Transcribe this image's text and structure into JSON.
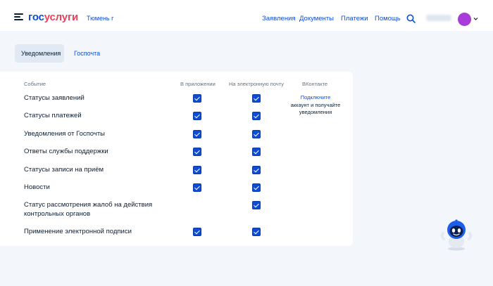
{
  "header": {
    "logo_part1": "гос",
    "logo_part2": "услуги",
    "city": "Тюмень г",
    "nav": [
      "Заявления",
      "Документы",
      "Платежи",
      "Помощь"
    ]
  },
  "tabs": [
    {
      "label": "Уведомления",
      "active": true
    },
    {
      "label": "Госпочта",
      "active": false
    }
  ],
  "table": {
    "columns": [
      "Событие",
      "В приложении",
      "На электронную почту",
      "ВКонтакте"
    ],
    "rows": [
      {
        "label": "Статусы заявлений",
        "app": true,
        "email": true
      },
      {
        "label": "Статусы платежей",
        "app": true,
        "email": true
      },
      {
        "label": "Уведомления от Госпочты",
        "app": true,
        "email": true
      },
      {
        "label": "Ответы службы поддержки",
        "app": true,
        "email": true
      },
      {
        "label": "Статусы записи на приём",
        "app": true,
        "email": true
      },
      {
        "label": "Новости",
        "app": true,
        "email": true
      },
      {
        "label_line1": "Статус рассмотрения жалоб на действия",
        "label_line2": "контрольных органов",
        "app": null,
        "email": true
      },
      {
        "label": "Применение электронной подписи",
        "app": true,
        "email": true
      }
    ],
    "vk_note": {
      "link": "Подключите",
      "line2": "аккаунт и получайте",
      "line3": "уведомления"
    }
  },
  "colors": {
    "accent": "#0d4cd3",
    "logo_red": "#ee3f58",
    "avatar": "#a93bd8",
    "page_bg": "#f3f6fb"
  },
  "icons": [
    "menu-icon",
    "search-icon",
    "chevron-down-icon",
    "avatar",
    "robot-assistant-icon"
  ]
}
